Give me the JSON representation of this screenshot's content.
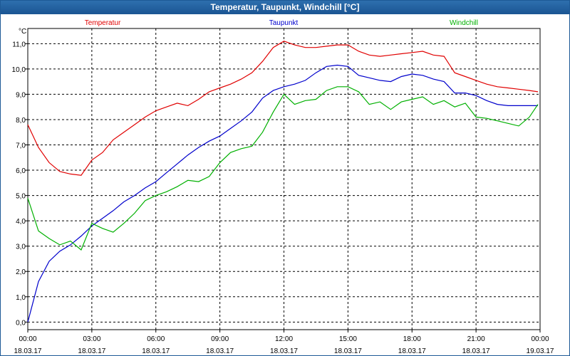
{
  "window": {
    "title": "Temperatur, Taupunkt, Windchill [°C]"
  },
  "colors": {
    "temperatur": "#e00000",
    "taupunkt": "#0000cc",
    "windchill": "#00b000",
    "grid": "#000000"
  },
  "chart_data": {
    "type": "line",
    "title": "Temperatur, Taupunkt, Windchill [°C]",
    "ylabel": "°C",
    "grid": true,
    "legend_placement": "top",
    "ylim": [
      -0.3,
      11.6
    ],
    "xlim": [
      0,
      24
    ],
    "y_ticks": [
      "0,0",
      "1,0",
      "2,0",
      "3,0",
      "4,0",
      "5,0",
      "6,0",
      "7,0",
      "8,0",
      "9,0",
      "10,0",
      "11,0"
    ],
    "x_ticks": [
      {
        "time": "00:00",
        "date": "18.03.17"
      },
      {
        "time": "03:00",
        "date": "18.03.17"
      },
      {
        "time": "06:00",
        "date": "18.03.17"
      },
      {
        "time": "09:00",
        "date": "18.03.17"
      },
      {
        "time": "12:00",
        "date": "18.03.17"
      },
      {
        "time": "15:00",
        "date": "18.03.17"
      },
      {
        "time": "18:00",
        "date": "18.03.17"
      },
      {
        "time": "21:00",
        "date": "18.03.17"
      },
      {
        "time": "00:00",
        "date": "19.03.17"
      }
    ],
    "x": [
      0,
      0.5,
      1,
      1.5,
      2,
      2.5,
      3,
      3.5,
      4,
      4.5,
      5,
      5.5,
      6,
      6.5,
      7,
      7.5,
      8,
      8.5,
      9,
      9.5,
      10,
      10.5,
      11,
      11.5,
      12,
      12.5,
      13,
      13.5,
      14,
      14.5,
      15,
      15.5,
      16,
      16.5,
      17,
      17.5,
      18,
      18.5,
      19,
      19.5,
      20,
      20.5,
      21,
      21.5,
      22,
      22.5,
      23,
      23.5,
      23.9
    ],
    "series": [
      {
        "name": "Temperatur",
        "values": [
          7.8,
          6.9,
          6.3,
          5.95,
          5.85,
          5.8,
          6.4,
          6.7,
          7.2,
          7.5,
          7.8,
          8.1,
          8.35,
          8.5,
          8.65,
          8.55,
          8.8,
          9.1,
          9.25,
          9.4,
          9.6,
          9.85,
          10.3,
          10.85,
          11.1,
          10.95,
          10.85,
          10.85,
          10.9,
          10.95,
          10.95,
          10.7,
          10.55,
          10.5,
          10.55,
          10.6,
          10.65,
          10.7,
          10.55,
          10.5,
          9.85,
          9.7,
          9.55,
          9.4,
          9.3,
          9.25,
          9.2,
          9.15,
          9.1
        ]
      },
      {
        "name": "Taupunkt",
        "values": [
          0.0,
          1.6,
          2.4,
          2.8,
          3.05,
          3.4,
          3.8,
          4.1,
          4.4,
          4.75,
          5.0,
          5.3,
          5.55,
          5.9,
          6.25,
          6.6,
          6.9,
          7.15,
          7.35,
          7.65,
          7.95,
          8.3,
          8.85,
          9.15,
          9.3,
          9.4,
          9.55,
          9.85,
          10.1,
          10.15,
          10.1,
          9.75,
          9.65,
          9.55,
          9.5,
          9.7,
          9.8,
          9.75,
          9.6,
          9.5,
          9.05,
          9.05,
          8.95,
          8.75,
          8.6,
          8.55,
          8.55,
          8.55,
          8.55
        ]
      },
      {
        "name": "Windchill",
        "values": [
          4.9,
          3.6,
          3.3,
          3.05,
          3.2,
          2.85,
          3.9,
          3.7,
          3.55,
          3.9,
          4.3,
          4.8,
          5.0,
          5.15,
          5.35,
          5.6,
          5.55,
          5.75,
          6.3,
          6.7,
          6.85,
          6.95,
          7.5,
          8.3,
          9.0,
          8.6,
          8.75,
          8.8,
          9.15,
          9.3,
          9.3,
          9.1,
          8.6,
          8.7,
          8.4,
          8.7,
          8.8,
          8.9,
          8.6,
          8.75,
          8.5,
          8.65,
          8.1,
          8.05,
          7.95,
          7.85,
          7.75,
          8.1,
          8.6
        ]
      }
    ]
  }
}
